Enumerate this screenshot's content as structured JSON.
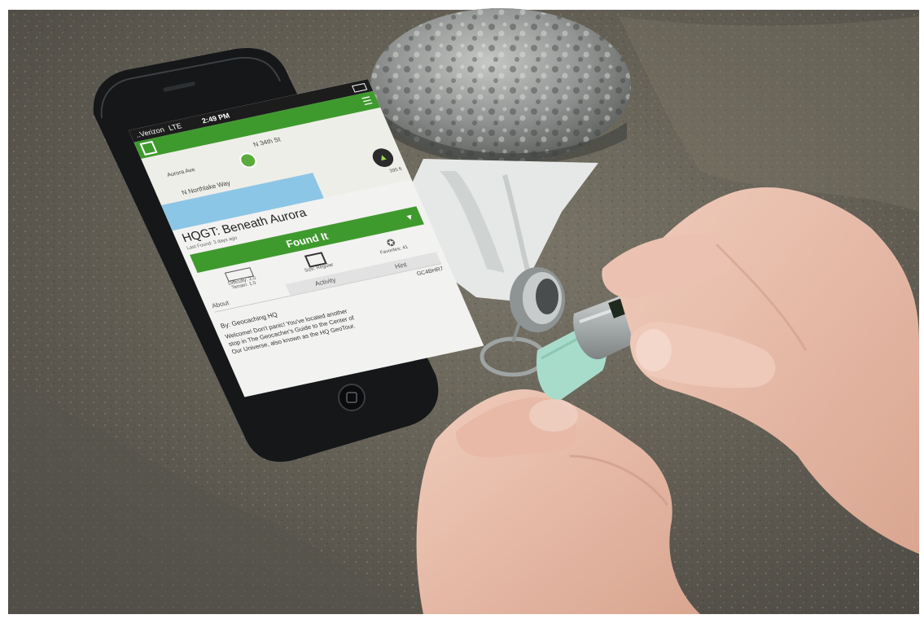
{
  "scene": {
    "description_colors": {
      "rock": "#6e6a62",
      "app_green": "#3f9a2e",
      "phone_body": "#141618",
      "skin": "#e9bfae"
    }
  },
  "phone": {
    "status": {
      "carrier": "..Verizon",
      "network": "LTE",
      "time": "2:49 PM"
    },
    "map": {
      "street1": "N 34th St",
      "street2": "N Northlake Way",
      "street3": "Aurora Ave",
      "distance": "395 ft"
    },
    "cache": {
      "title": "HQGT: Beneath Aurora",
      "last_found": "Last Found: 3 days ago",
      "found_button": "Found It",
      "size": "Size: Regular",
      "favorites": "Favorites: 41",
      "difficulty": "Difficulty: 2.0",
      "terrain": "Terrain: 1.0",
      "code": "GC4BHR7"
    },
    "tabs": {
      "about": "About",
      "activity": "Activity",
      "hint": "Hint"
    },
    "description": {
      "by": "By: Geocaching HQ",
      "line1": "Welcome! Don't panic! You've located another",
      "line2": "stop in The Geocacher's Guide to the Center of",
      "line3": "Our Universe, also known as the HQ GeoTour."
    }
  }
}
